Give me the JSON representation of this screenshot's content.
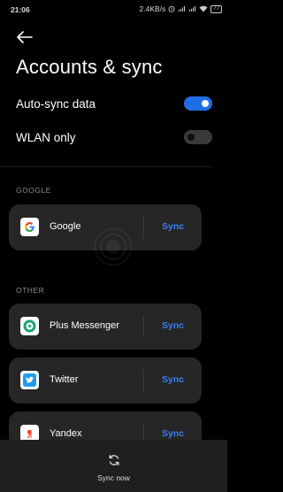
{
  "status_bar": {
    "time": "21:06",
    "network_speed": "2.4KB/s",
    "battery": "77"
  },
  "header": {
    "title": "Accounts & sync"
  },
  "settings": {
    "auto_sync_label": "Auto-sync data",
    "auto_sync_on": true,
    "wlan_only_label": "WLAN only",
    "wlan_only_on": false
  },
  "sections": {
    "google_label": "GOOGLE",
    "other_label": "OTHER"
  },
  "accounts": [
    {
      "name": "Google",
      "sync_label": "Sync",
      "icon": "google-icon"
    },
    {
      "name": "Plus Messenger",
      "sync_label": "Sync",
      "icon": "plus-messenger-icon"
    },
    {
      "name": "Twitter",
      "sync_label": "Sync",
      "icon": "twitter-icon"
    },
    {
      "name": "Yandex",
      "sync_label": "Sync",
      "icon": "yandex-icon"
    }
  ],
  "footer": {
    "sync_now_label": "Sync now"
  },
  "colors": {
    "accent": "#1e6fe6",
    "sync_text": "#3a7ff0",
    "card_bg": "#262626"
  }
}
